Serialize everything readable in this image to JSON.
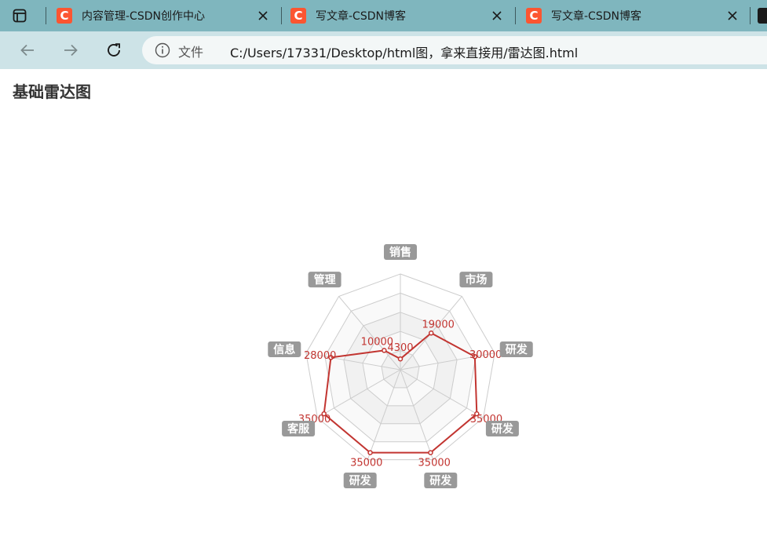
{
  "tabs": [
    {
      "title": "内容管理-CSDN创作中心",
      "favicon": "C"
    },
    {
      "title": "写文章-CSDN博客",
      "favicon": "C"
    },
    {
      "title": "写文章-CSDN博客",
      "favicon": "C"
    }
  ],
  "address": {
    "label": "文件",
    "url": "C:/Users/17331/Desktop/html图，拿来直接用/雷达图.html"
  },
  "page": {
    "title": "基础雷达图"
  },
  "colors": {
    "series": "#c23531",
    "tabbar": "#7fb6be",
    "toolbar": "#cde3e7"
  },
  "icons": [
    "tab-strip-icon",
    "close-icon",
    "back-arrow-icon",
    "forward-arrow-icon",
    "reload-icon",
    "info-icon"
  ],
  "chart_data": {
    "type": "radar",
    "title": "",
    "indicators": [
      "销售",
      "市场",
      "研发",
      "研发",
      "研发",
      "研发",
      "客服",
      "信息",
      "管理"
    ],
    "max": 38000,
    "series": [
      {
        "values": [
          4300,
          19000,
          30000,
          35000,
          35000,
          35000,
          35000,
          28000,
          10000
        ],
        "labels": [
          "4300",
          "19000",
          "30000",
          "35000",
          "35000",
          "35000",
          "35000",
          "28000",
          "10000"
        ]
      }
    ],
    "split_number": 5,
    "split_area": true,
    "legend": false
  }
}
